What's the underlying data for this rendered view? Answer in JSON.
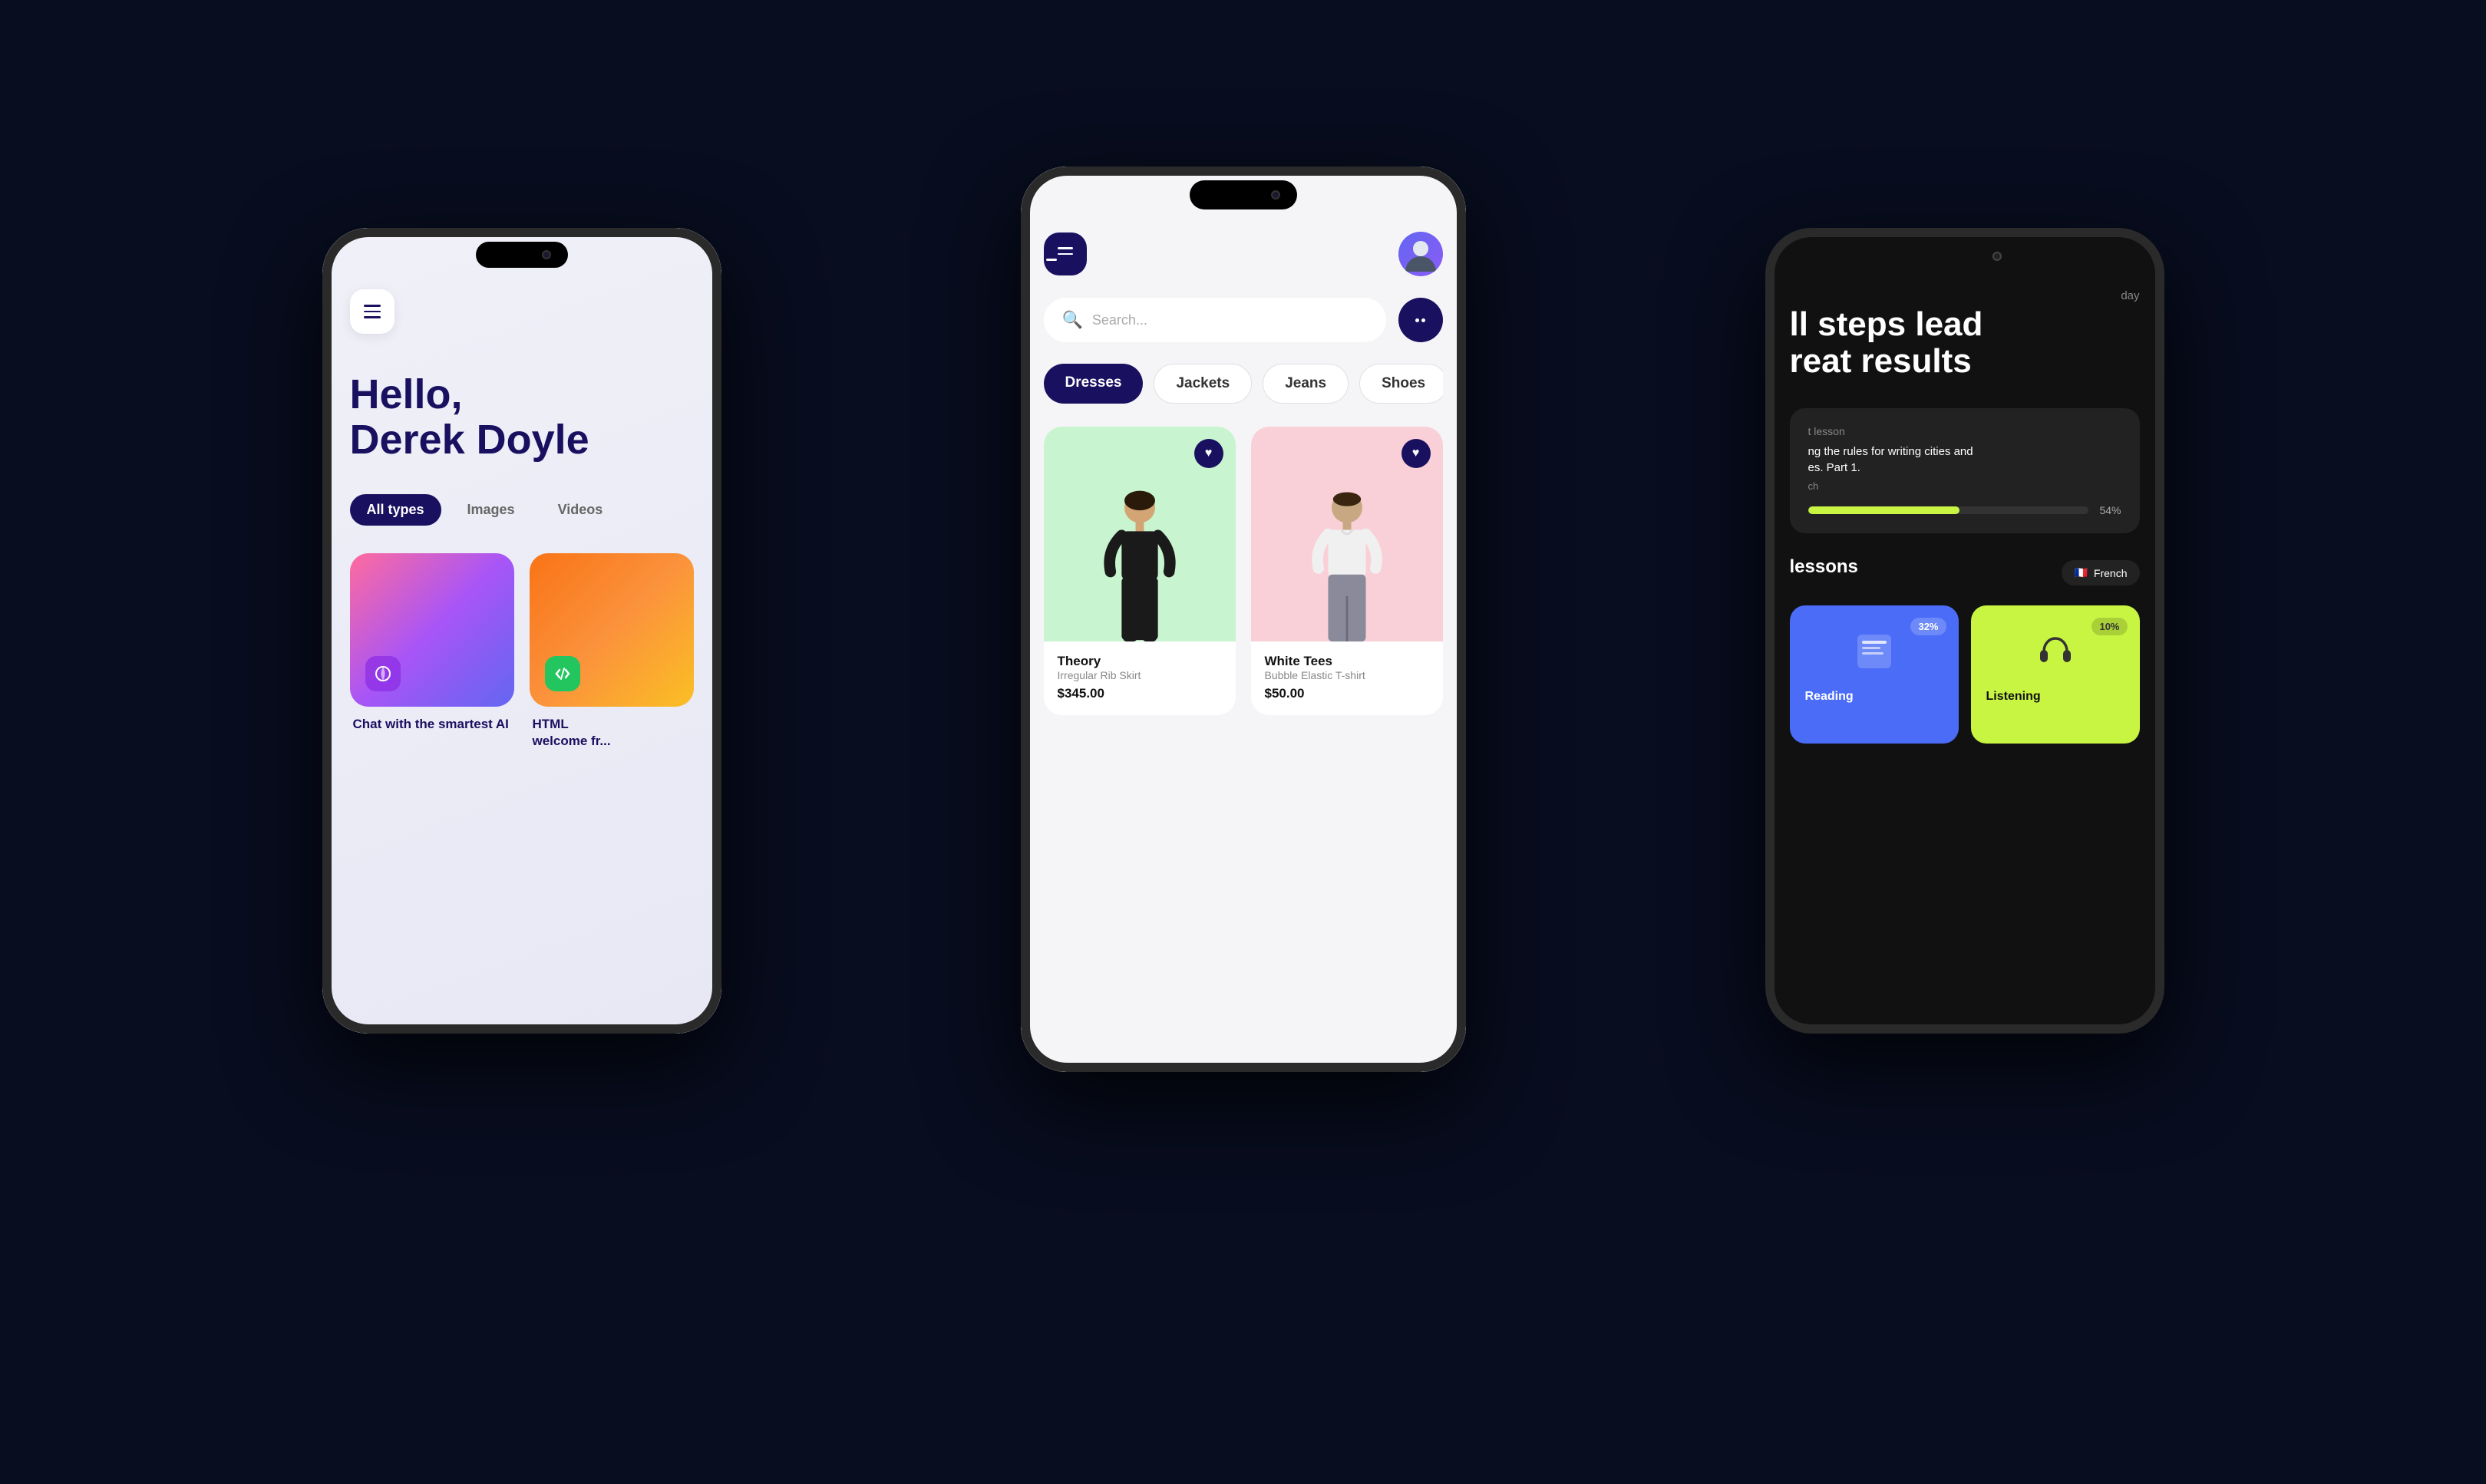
{
  "scene": {
    "background": "#080d1f"
  },
  "leftPhone": {
    "greeting": "Hello,\nDerek Doyle",
    "hamburger_lines": 3,
    "filters": [
      {
        "label": "All types",
        "active": true
      },
      {
        "label": "Images",
        "active": false
      },
      {
        "label": "Videos",
        "active": false
      }
    ],
    "cards": [
      {
        "label": "Chat with the smartest AI",
        "bg": "gradient-rainbow",
        "icon": "adjust-icon"
      },
      {
        "label": "HTML welcome fr...",
        "bg": "gradient-orange",
        "icon": "code-icon"
      }
    ]
  },
  "centerPhone": {
    "search_placeholder": "Search...",
    "categories": [
      {
        "label": "Dresses",
        "active": true
      },
      {
        "label": "Jackets",
        "active": false
      },
      {
        "label": "Jeans",
        "active": false
      },
      {
        "label": "Shoes",
        "active": false
      }
    ],
    "products": [
      {
        "brand": "Theory",
        "name": "Irregular Rib Skirt",
        "price": "$345.00",
        "bg": "green"
      },
      {
        "brand": "White Tees",
        "name": "Bubble Elastic T-shirt",
        "price": "$50.00",
        "bg": "pink"
      }
    ]
  },
  "rightPhone": {
    "day_label": "day",
    "headline": "ll steps lead\nreat results",
    "lesson": {
      "label": "t lesson",
      "title": "ng the rules for writing cities and\nes. Part 1.",
      "lang": "ch",
      "progress": 54,
      "progress_label": "54%"
    },
    "lessons_section": "lessons",
    "language": {
      "flag": "🇫🇷",
      "name": "French"
    },
    "skills": [
      {
        "name": "Listening",
        "pct": "10%",
        "color": "yellow"
      },
      {
        "name": "Reading",
        "pct": "32%",
        "color": "blue"
      }
    ]
  }
}
